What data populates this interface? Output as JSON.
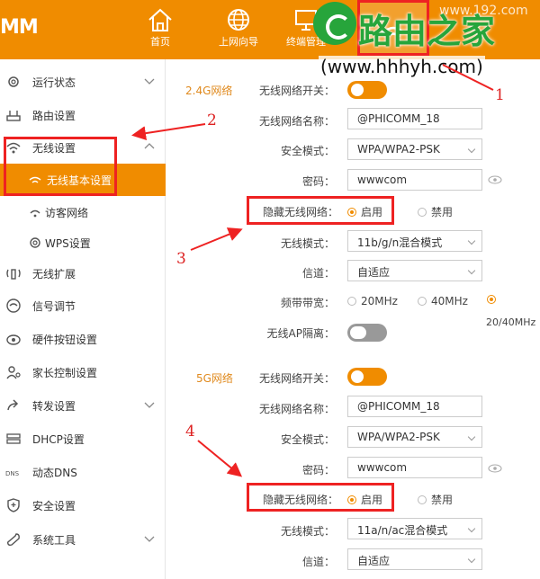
{
  "header": {
    "logo": "MM",
    "nav": [
      {
        "label": "首页",
        "icon": "home-icon"
      },
      {
        "label": "上网向导",
        "icon": "globe-icon"
      },
      {
        "label": "终端管理",
        "icon": "monitor-icon"
      },
      {
        "label": "",
        "icon": "wifi-settings-icon"
      }
    ]
  },
  "watermark": {
    "title": "路由之家",
    "url": "(www.hhhyh.com)",
    "url_bg": "www.192.com"
  },
  "sidebar": {
    "items": [
      {
        "label": "运行状态",
        "icon": "gear-icon",
        "chevron": "down"
      },
      {
        "label": "路由设置",
        "icon": "router-icon"
      },
      {
        "label": "无线设置",
        "icon": "wifi-icon",
        "chevron": "up"
      },
      {
        "label": "无线基本设置",
        "icon": "wifi-small-icon",
        "active": true
      },
      {
        "label": "访客网络",
        "icon": "guest-icon"
      },
      {
        "label": "WPS设置",
        "icon": "gear-icon"
      },
      {
        "label": "无线扩展",
        "icon": "extender-icon"
      },
      {
        "label": "信号调节",
        "icon": "signal-icon"
      },
      {
        "label": "硬件按钮设置",
        "icon": "button-icon"
      },
      {
        "label": "家长控制设置",
        "icon": "parent-icon"
      },
      {
        "label": "转发设置",
        "icon": "forward-icon",
        "chevron": "down"
      },
      {
        "label": "DHCP设置",
        "icon": "dhcp-icon"
      },
      {
        "label": "动态DNS",
        "icon": "dns-icon"
      },
      {
        "label": "安全设置",
        "icon": "shield-icon"
      },
      {
        "label": "系统工具",
        "icon": "wrench-icon",
        "chevron": "down"
      }
    ]
  },
  "band24": {
    "section": "2.4G网络",
    "switch_label": "无线网络开关：",
    "switch_on": true,
    "ssid_label": "无线网络名称：",
    "ssid": "@PHICOMM_18",
    "security_label": "安全模式：",
    "security": "WPA/WPA2-PSK",
    "password_label": "密码：",
    "password": "wwwcom",
    "hide_label": "隐藏无线网络：",
    "hide_enable": "启用",
    "hide_disable": "禁用",
    "mode_label": "无线模式：",
    "mode": "11b/g/n混合模式",
    "channel_label": "信道：",
    "channel": "自适应",
    "bandwidth_label": "频带带宽：",
    "bw_20": "20MHz",
    "bw_40": "40MHz",
    "bw_2040": "20/40MHz",
    "ap_isolation_label": "无线AP隔离：",
    "ap_isolation_on": false
  },
  "band5": {
    "section": "5G网络",
    "switch_label": "无线网络开关：",
    "switch_on": true,
    "ssid_label": "无线网络名称：",
    "ssid": "@PHICOMM_18",
    "security_label": "安全模式：",
    "security": "WPA/WPA2-PSK",
    "password_label": "密码：",
    "password": "wwwcom",
    "hide_label": "隐藏无线网络：",
    "hide_enable": "启用",
    "hide_disable": "禁用",
    "mode_label": "无线模式：",
    "mode": "11a/n/ac混合模式",
    "channel_label": "信道：",
    "channel": "自适应"
  },
  "annotations": [
    "1",
    "2",
    "3",
    "4"
  ],
  "colors": {
    "accent": "#f08c00",
    "annotation": "#e22222",
    "watermark": "#27a53b"
  }
}
